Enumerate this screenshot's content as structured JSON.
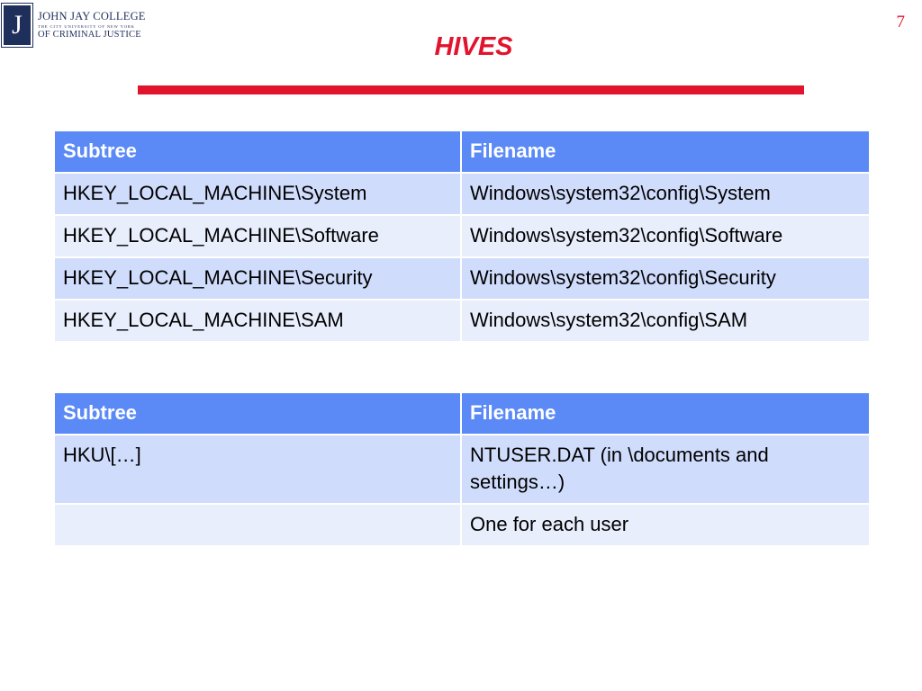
{
  "logo": {
    "monogram": "J",
    "line1": "JOHN JAY COLLEGE",
    "line2": "THE CITY UNIVERSITY OF NEW YORK",
    "line3": "OF CRIMINAL JUSTICE"
  },
  "page_number": "7",
  "title": "HIVES",
  "colors": {
    "accent": "#e2142d",
    "header_fill": "#5b8af7",
    "row_odd": "#d0dcfb",
    "row_even": "#e8eefc",
    "logo_navy": "#1f2f5c"
  },
  "table1": {
    "headers": [
      "Subtree",
      "Filename"
    ],
    "rows": [
      [
        "HKEY_LOCAL_MACHINE\\System",
        "Windows\\system32\\config\\System"
      ],
      [
        "HKEY_LOCAL_MACHINE\\Software",
        "Windows\\system32\\config\\Software"
      ],
      [
        "HKEY_LOCAL_MACHINE\\Security",
        "Windows\\system32\\config\\Security"
      ],
      [
        "HKEY_LOCAL_MACHINE\\SAM",
        "Windows\\system32\\config\\SAM"
      ]
    ]
  },
  "table2": {
    "headers": [
      "Subtree",
      "Filename"
    ],
    "rows": [
      [
        "HKU\\[…]",
        "NTUSER.DAT (in \\documents and settings…)"
      ],
      [
        "",
        "One for each user"
      ]
    ]
  }
}
